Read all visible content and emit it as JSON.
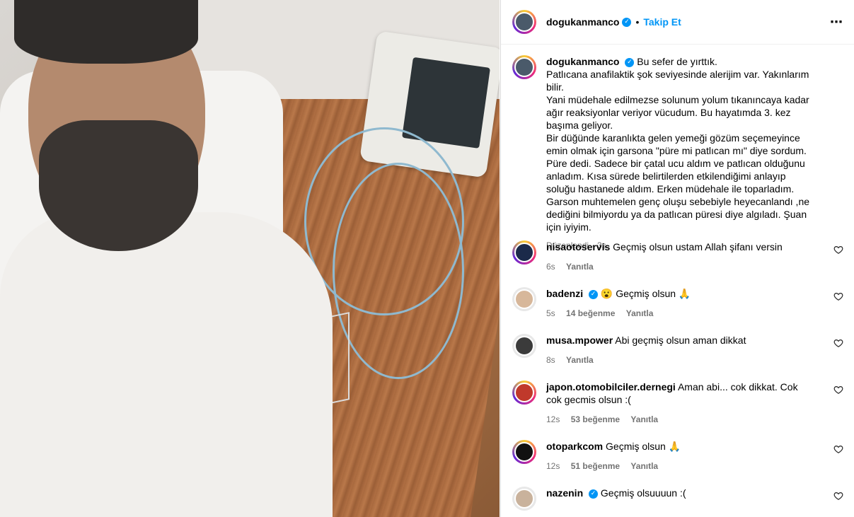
{
  "header": {
    "username": "dogukanmanco",
    "separator": "•",
    "follow_label": "Takip Et",
    "more_icon": "⋯"
  },
  "caption": {
    "username": "dogukanmanco",
    "first_line": "Bu sefer de yırttık.",
    "body": "Patlıcana anafilaktik şok seviyesinde alerijim var. Yakınlarım bilir.\nYani müdehale edilmezse solunum yolum tıkanıncaya kadar ağır reaksiyonlar veriyor vücudum. Bu hayatımda 3. kez başıma geliyor.\nBir düğünde karanlıkta gelen yemeği gözüm seçemeyince emin olmak için garsona \"püre mi patlıcan mı\" diye sordum. Püre dedi. Sadece bir çatal ucu aldım ve patlıcan olduğunu anladım. Kısa sürede belirtilerden etkilendiğimi anlayıp soluğu hastanede aldım. Erken müdehale ile toparladım. Garson muhtemelen genç oluşu sebebiyle heyecanlandı ,ne dediğini bilmiyordu ya da patlıcan püresi diye algıladı. Şuan için iyiyim.",
    "edited_label": "Düzenlendi",
    "time": "3s"
  },
  "comments": [
    {
      "username": "nisaotoservis",
      "verified": false,
      "text": "Geçmiş olsun ustam Allah şifanı versin",
      "time": "6s",
      "likes": "",
      "reply": "Yanıtla",
      "avatar_color": "#1b2a4a"
    },
    {
      "username": "badenzi",
      "verified": true,
      "text": "😮 Geçmiş olsun 🙏",
      "time": "5s",
      "likes": "14 beğenme",
      "reply": "Yanıtla",
      "avatar_color": "#d7b79a"
    },
    {
      "username": "musa.mpower",
      "verified": false,
      "text": "Abi geçmiş olsun aman dikkat",
      "time": "8s",
      "likes": "",
      "reply": "Yanıtla",
      "avatar_color": "#3b3b3b"
    },
    {
      "username": "japon.otomobilciler.dernegi",
      "verified": false,
      "text": "Aman abi... cok dikkat. Cok cok gecmis olsun :(",
      "time": "12s",
      "likes": "53 beğenme",
      "reply": "Yanıtla",
      "avatar_color": "#c0392b"
    },
    {
      "username": "otoparkcom",
      "verified": false,
      "text": "Geçmiş olsun 🙏",
      "time": "12s",
      "likes": "51 beğenme",
      "reply": "Yanıtla",
      "avatar_color": "#111111"
    },
    {
      "username": "nazenin",
      "verified": true,
      "text": "Geçmiş olsuuuun :(",
      "time": "",
      "likes": "",
      "reply": "",
      "avatar_color": "#c9b29c"
    }
  ]
}
